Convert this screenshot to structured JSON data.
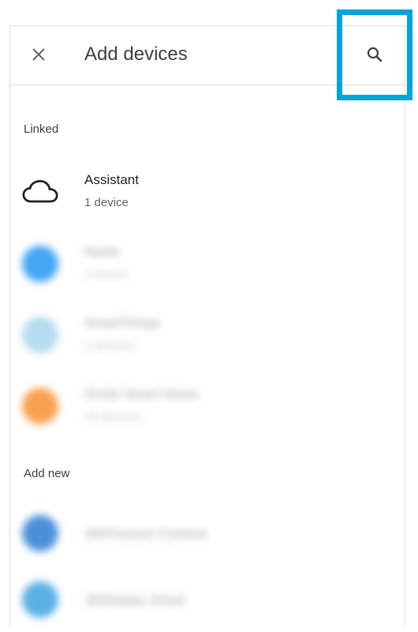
{
  "header": {
    "title": "Add devices",
    "close_icon": "close-icon",
    "search_icon": "search-icon"
  },
  "sections": {
    "linked": "Linked",
    "add_new": "Add new"
  },
  "linked_items": [
    {
      "name": "Assistant",
      "sub": "1 device",
      "icon": "cloud-icon",
      "color": "#202124",
      "blurred": false
    },
    {
      "name": "Nanle",
      "sub": "1 device",
      "icon": "brand-icon",
      "color": "#42a5f5",
      "blurred": true
    },
    {
      "name": "SmartThings",
      "sub": "2 devices",
      "icon": "brand-icon",
      "color": "#b3dcef",
      "blurred": true
    },
    {
      "name": "Orvibi Smart Home",
      "sub": "16 devices",
      "icon": "brand-icon",
      "color": "#f9a04f",
      "blurred": true
    }
  ],
  "add_new_items": [
    {
      "name": "360Faucam Camera",
      "icon": "brand-icon",
      "color": "#4a90d9",
      "blurred": true
    },
    {
      "name": "360Nadau Smart",
      "icon": "brand-icon",
      "color": "#5ab0e6",
      "blurred": true
    }
  ],
  "colors": {
    "highlight": "#00a3e0",
    "divider": "#dadce0"
  }
}
